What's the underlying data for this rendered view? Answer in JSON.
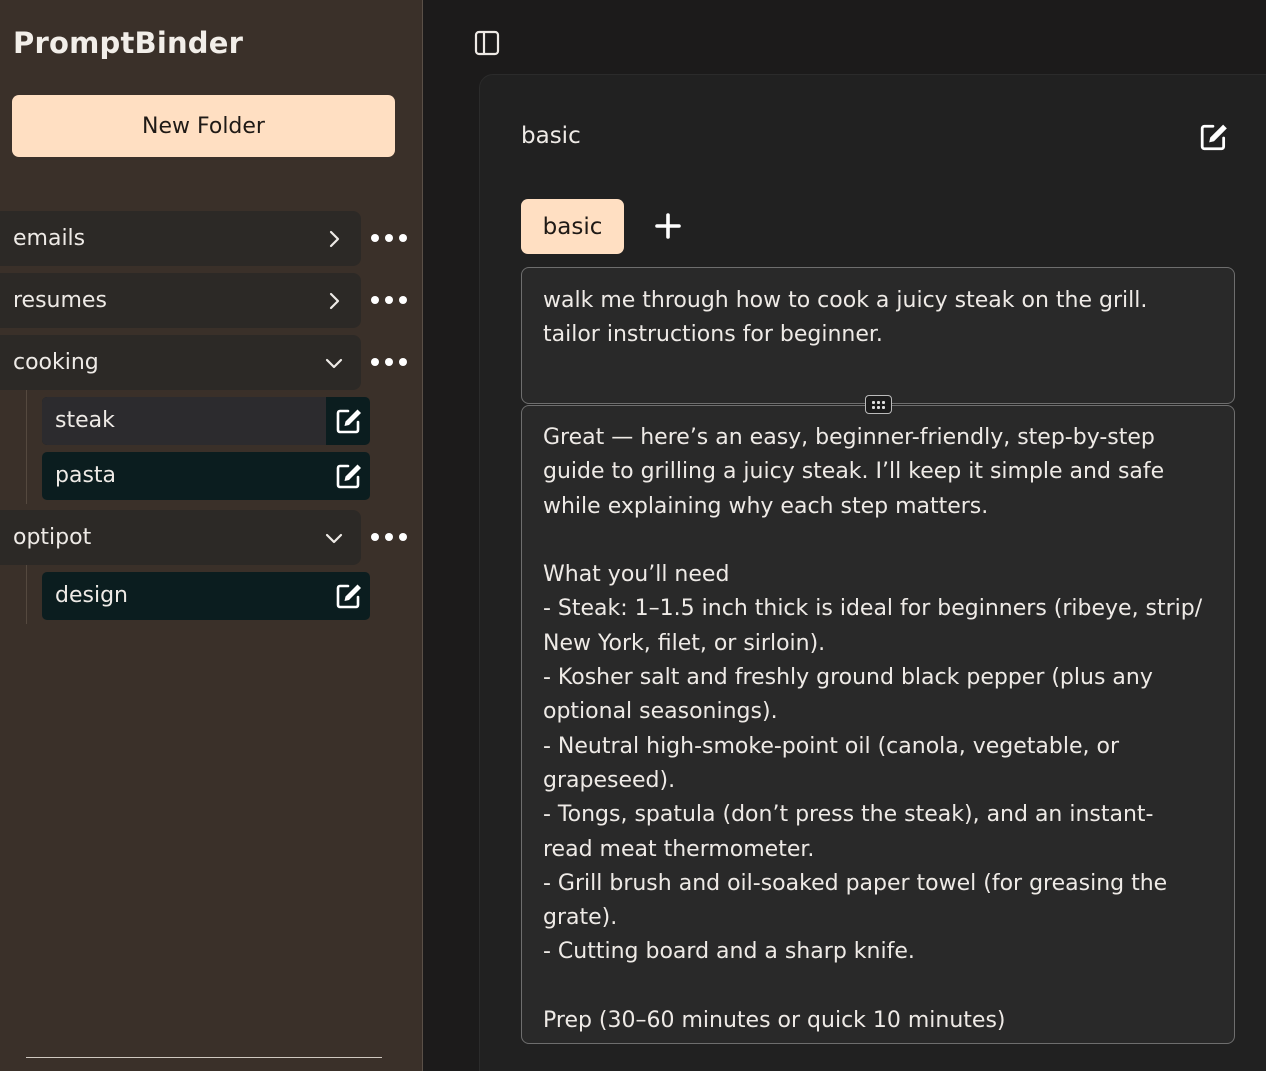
{
  "app": {
    "title": "PromptBinder"
  },
  "sidebar": {
    "new_folder_label": "New Folder",
    "folders": [
      {
        "label": "emails",
        "expanded": false
      },
      {
        "label": "resumes",
        "expanded": false
      },
      {
        "label": "cooking",
        "expanded": true,
        "items": [
          {
            "label": "steak",
            "selected": true
          },
          {
            "label": "pasta"
          }
        ]
      },
      {
        "label": "optipot",
        "expanded": true,
        "items": [
          {
            "label": "design"
          }
        ]
      }
    ],
    "icons": {
      "more": "more-horizontal-icon",
      "collapsed": "chevron-right-icon",
      "expanded": "chevron-down-icon",
      "edit": "edit-icon"
    }
  },
  "main": {
    "title": "basic",
    "tabs": [
      {
        "label": "basic",
        "active": true
      }
    ],
    "prompt_text": "walk me through how to cook a juicy steak on the grill.\ntailor instructions for beginner.",
    "response_text": "Great — here’s an easy, beginner-friendly, step-by-step\nguide to grilling a juicy steak. I’ll keep it simple and safe\nwhile explaining why each step matters.\n\nWhat you’ll need\n- Steak: 1–1.5 inch thick is ideal for beginners (ribeye, strip/\nNew York, filet, or sirloin).\n- Kosher salt and freshly ground black pepper (plus any\noptional seasonings).\n- Neutral high-smoke-point oil (canola, vegetable, or\ngrapeseed).\n- Tongs, spatula (don’t press the steak), and an instant-\nread meat thermometer.\n- Grill brush and oil-soaked paper towel (for greasing the\ngrate).\n- Cutting board and a sharp knife.\n\nPrep (30–60 minutes or quick 10 minutes)"
  },
  "colors": {
    "sidebar_bg": "#3a3029",
    "accent": "#ffdfc2",
    "folder_bg": "#2c2926",
    "item_bg": "#0b1d1f",
    "main_bg": "#1c1b1b",
    "card_bg": "#212121"
  }
}
